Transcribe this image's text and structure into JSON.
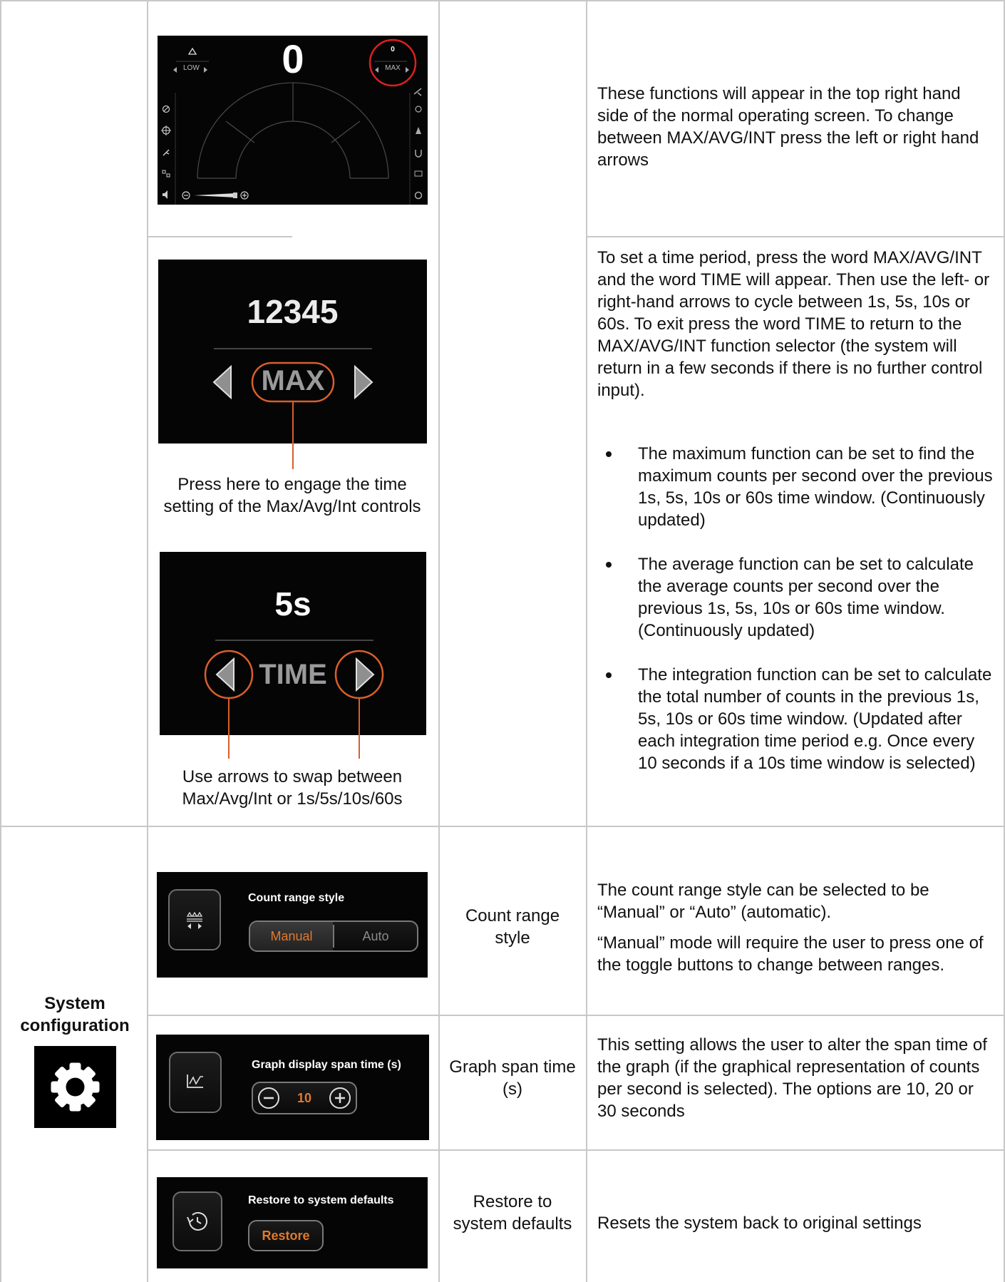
{
  "row1": {
    "screen": {
      "big_value": "0",
      "low_label": "LOW",
      "max_value": "0",
      "max_label": "MAX"
    },
    "description": "These functions will appear in the top right hand side of the normal operating screen. To change between MAX/AVG/INT press the left or right hand arrows"
  },
  "row2": {
    "screen_a": {
      "value": "12345",
      "mode": "MAX"
    },
    "caption_a": "Press here to engage the time setting of the Max/Avg/Int controls",
    "screen_b": {
      "value": "5s",
      "mode": "TIME"
    },
    "caption_b": "Use arrows to swap between Max/Avg/Int or 1s/5s/10s/60s",
    "intro": "To set a time period, press the word MAX/AVG/INT and the word TIME will appear. Then use the left- or right-hand arrows to cycle between 1s, 5s, 10s or 60s. To exit press the word TIME to return to the MAX/AVG/INT function selector (the system will return in a few seconds if there is no further control input).",
    "bullets": [
      "The maximum function can be set to find the maximum counts per second over the previous 1s, 5s, 10s or 60s time window. (Continuously updated)",
      "The average function can be set to calculate the average counts per second over the previous 1s, 5s, 10s or 60s time window. (Continuously updated)",
      "The integration function can be set to calculate the total number of counts in the previous 1s, 5s, 10s or 60s time window. (Updated after each integration time period e.g. Once every 10 seconds if a 10s time window is selected)"
    ]
  },
  "section": {
    "title": "System configuration",
    "icon": "gear-icon"
  },
  "row3": {
    "ui_title": "Count range style",
    "toggle_left": "Manual",
    "toggle_right": "Auto",
    "name": "Count range style",
    "desc_1": "The count range style can be selected to be “Manual” or “Auto” (automatic).",
    "desc_2": "“Manual” mode will require the user to press one of the toggle buttons to change between ranges."
  },
  "row4": {
    "ui_title": "Graph display span time (s)",
    "stepper_value": "10",
    "name": "Graph span time (s)",
    "desc": "This setting allows the user to alter the span time of the graph (if the graphical representation of counts per second is selected). The options are 10, 20 or 30 seconds"
  },
  "row5": {
    "ui_title": "Restore to system defaults",
    "button": "Restore",
    "name": "Restore to system defaults",
    "desc": "Resets the system back to original settings"
  },
  "colors": {
    "orange": "#e07a2d",
    "red_circle": "#e01e1e",
    "grid": "#c8c8c8"
  }
}
